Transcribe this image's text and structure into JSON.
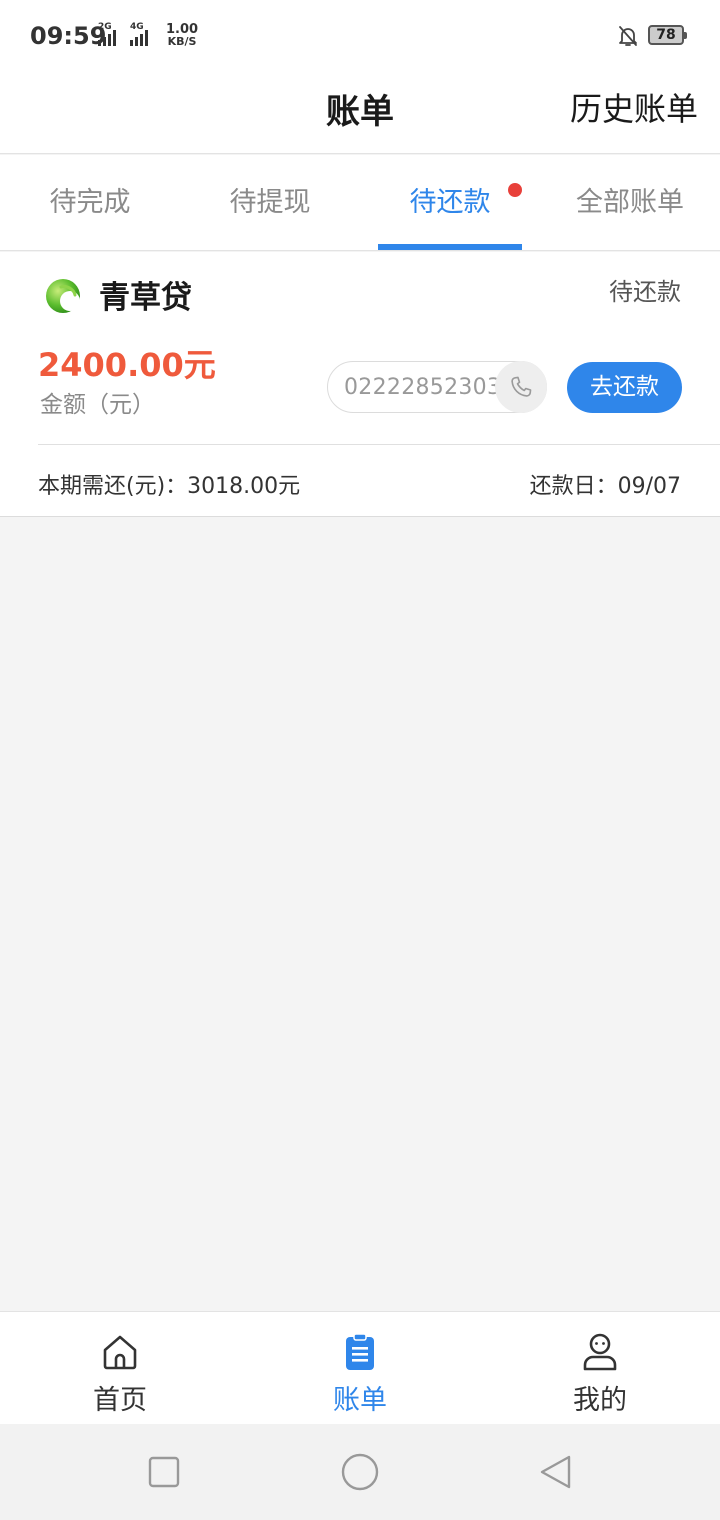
{
  "status_bar": {
    "time": "09:59",
    "signal_1_tag": "2G",
    "signal_2_tag": "4G",
    "net_speed_value": "1.00",
    "net_speed_unit": "KB/S",
    "battery": "78",
    "icons": [
      "signal-icon",
      "signal-icon",
      "bell-off-icon",
      "battery-icon"
    ]
  },
  "header": {
    "title": "账单",
    "history_link": "历史账单"
  },
  "tabs": [
    {
      "label": "待完成",
      "active": false
    },
    {
      "label": "待提现",
      "active": false
    },
    {
      "label": "待还款",
      "active": true,
      "badge_dot": true
    },
    {
      "label": "全部账单",
      "active": false
    }
  ],
  "bill_card": {
    "lender_name": "青草贷",
    "lender_logo_icon": "lender-logo",
    "status": "待还款",
    "amount": "2400.00元",
    "amount_label": "金额（元）",
    "phone": "02222852303",
    "phone_icon": "phone-icon",
    "repay_button": "去还款",
    "due_amount": "本期需还(元)：3018.00元",
    "due_date": "还款日：09/07"
  },
  "bottom_nav": [
    {
      "label": "首页",
      "icon": "home-icon",
      "active": false
    },
    {
      "label": "账单",
      "icon": "bill-icon",
      "active": true
    },
    {
      "label": "我的",
      "icon": "profile-icon",
      "active": false
    }
  ],
  "system_nav": {
    "icons": [
      "recents-icon",
      "home-circle-icon",
      "back-icon"
    ]
  },
  "colors": {
    "accent": "#2f86ea",
    "amount": "#ef5a3c",
    "badge": "#e8403a",
    "background": "#f4f4f4"
  }
}
